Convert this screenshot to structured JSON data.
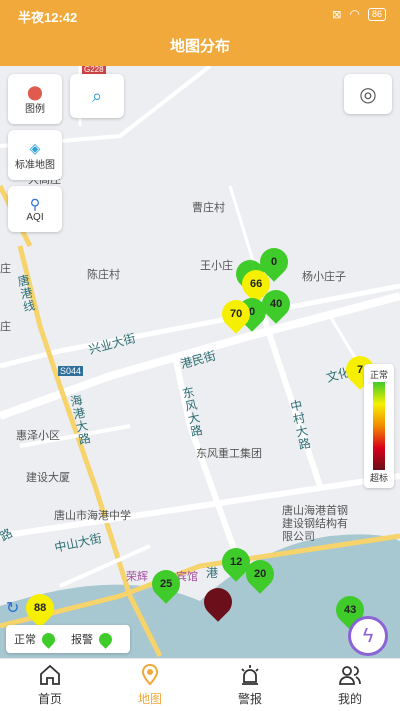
{
  "status_bar": {
    "time": "半夜12:42",
    "battery": "86"
  },
  "header": {
    "title": "地图分布"
  },
  "controls": {
    "legend_label": "图例",
    "standard_map_label": "标准地图",
    "aqi_label": "AQI"
  },
  "map_labels": {
    "road_code": "G228",
    "cao_zhuang_cun": "曹庄村",
    "wang_xiao_zhuang": "王小庄",
    "yang_xiao_zhuang": "杨小庄子",
    "chen_zhuang_cun": "陈庄村",
    "xing_ye_da_jie": "兴业大街",
    "tang_gang_xian": "唐港线",
    "s044": "S044",
    "gang_min_jie": "港民街",
    "wen_hua": "文化",
    "hai_gang_da_lu": "海港大路",
    "dong_feng_da_lu": "东风大路",
    "zhong_cun_da_lu": "中村大路",
    "hui_ze_xiao_qu": "惠泽小区",
    "jian_she_da_sha": "建设大厦",
    "dong_feng_group": "东风重工集团",
    "tangshan_school": "唐山市海港中学",
    "tangshan_steel": "唐山海港首钢建设钢结构有限公司",
    "zhong_shan_da_jie": "中山大街",
    "rong_hui": "荣辉",
    "hotel_suffix": "宾馆",
    "gang_prefix": "港",
    "zhuang_left": "庄",
    "zhuang_left2": "庄",
    "da_ge_zhuang": "大高庄",
    "da_lu_left": "路"
  },
  "pins": [
    {
      "value": "0"
    },
    {
      "value": "66"
    },
    {
      "value": "40"
    },
    {
      "value": "70"
    },
    {
      "value": "0"
    },
    {
      "value": "12"
    },
    {
      "value": "20"
    },
    {
      "value": "25"
    },
    {
      "value": "88"
    },
    {
      "value": "43"
    },
    {
      "value": ""
    },
    {
      "value": "7"
    }
  ],
  "aqi_legend": {
    "top": "正常",
    "bottom": "超标"
  },
  "status_legend": {
    "normal": "正常",
    "alarm": "报警"
  },
  "tabs": [
    {
      "label": "首页"
    },
    {
      "label": "地图"
    },
    {
      "label": "警报"
    },
    {
      "label": "我的"
    }
  ],
  "colors": {
    "accent": "#f2a93b",
    "pin_good": "#3fcb2a",
    "pin_moderate": "#f6f000",
    "pin_severe": "#6b0f1a"
  }
}
